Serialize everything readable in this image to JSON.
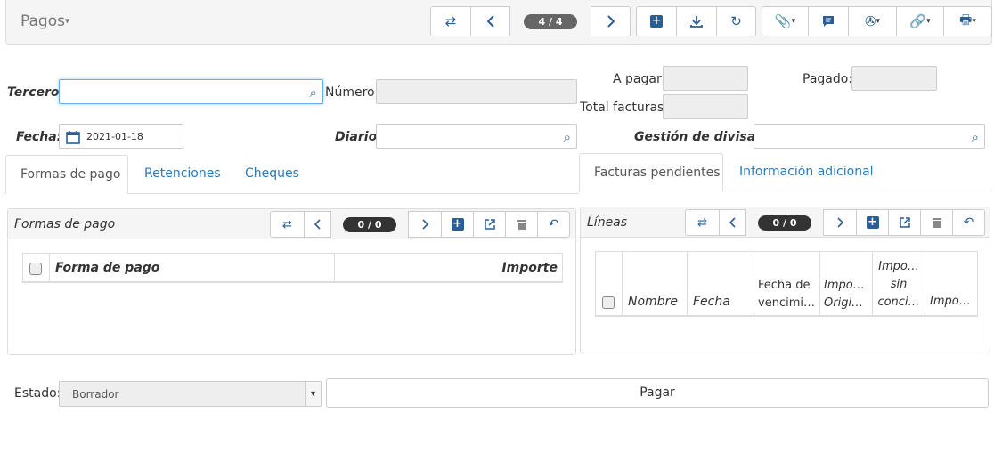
{
  "header": {
    "title": "Pagos",
    "record_counter": "4 / 4"
  },
  "form": {
    "tercero_label": "Tercero:",
    "tercero_value": "",
    "numero_label": "Número:",
    "numero_value": "",
    "a_pagar_label": "A pagar:",
    "a_pagar_value": "",
    "pagado_label": "Pagado:",
    "pagado_value": "",
    "total_facturas_label": "Total facturas:",
    "total_facturas_value": "",
    "fecha_label": "Fecha:",
    "fecha_value": "2021-01-18",
    "diario_label": "Diario:",
    "diario_value": "",
    "gestion_label": "Gestión de divisas:",
    "gestion_value": ""
  },
  "left_tabs": [
    "Formas de pago",
    "Retenciones",
    "Cheques"
  ],
  "right_tabs": [
    "Facturas pendientes",
    "Información adicional"
  ],
  "left_panel": {
    "title": "Formas de pago",
    "counter": "0 / 0",
    "columns": [
      "Forma de pago",
      "Importe"
    ]
  },
  "right_panel": {
    "title": "Líneas",
    "counter": "0 / 0",
    "columns": [
      "Nombre",
      "Fecha",
      "Fecha de vencimi…",
      "Impo… Origi…",
      "Impo… sin conci…",
      "Impo…"
    ]
  },
  "footer": {
    "estado_label": "Estado:",
    "estado_value": "Borrador",
    "pagar_label": "Pagar"
  },
  "colors": {
    "accent": "#2a5e95",
    "link": "#2a7ab9"
  }
}
